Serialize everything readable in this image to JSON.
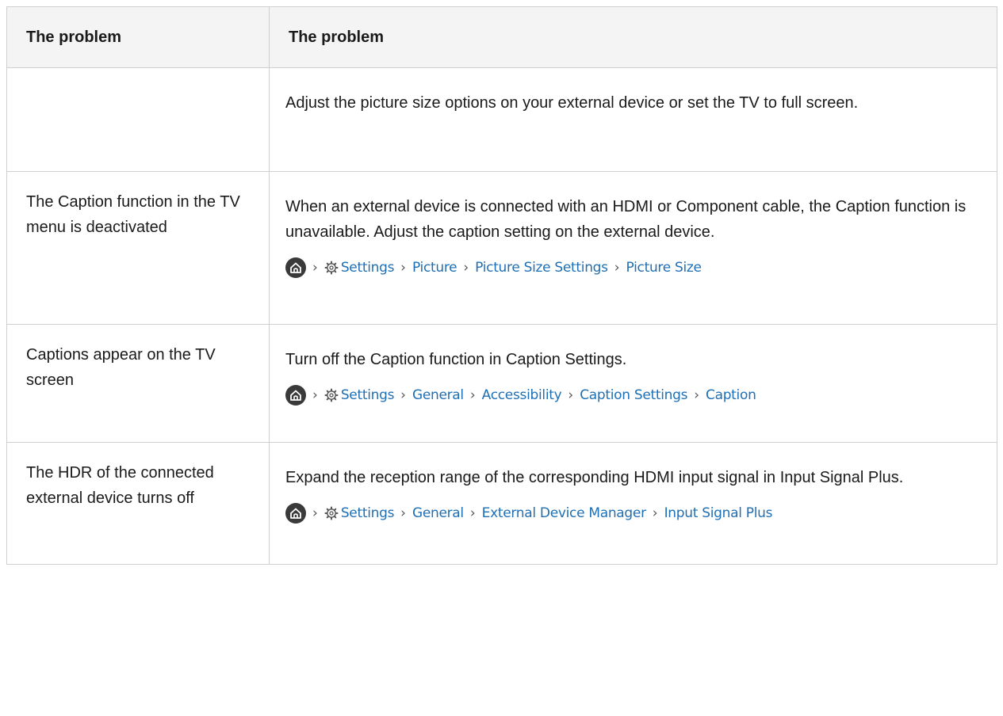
{
  "header": {
    "col1": "The problem",
    "col2": "The problem"
  },
  "rows": [
    {
      "problem": "",
      "solution": "Adjust the picture size options on your external device or set the TV to full screen.",
      "path": []
    },
    {
      "problem": "The Caption function in the TV menu is deactivated",
      "solution": "When an external device is connected with an HDMI or Component cable, the Caption function is unavailable. Adjust the caption setting on the external device.",
      "path": [
        "Settings",
        "Picture",
        "Picture Size Settings",
        "Picture Size"
      ]
    },
    {
      "problem": "Captions appear on the TV screen",
      "solution": "Turn off the Caption function in Caption Settings.",
      "path": [
        "Settings",
        "General",
        "Accessibility",
        "Caption Settings",
        "Caption"
      ]
    },
    {
      "problem": "The HDR of the connected external device turns off",
      "solution": "Expand the reception range of the corresponding HDMI input signal in Input Signal Plus.",
      "path": [
        "Settings",
        "General",
        "External Device Manager",
        "Input Signal Plus"
      ]
    }
  ],
  "icons": {
    "home": "home-icon",
    "settings": "gear-icon",
    "separator": "chevron-right-icon"
  },
  "colors": {
    "link": "#1f6fb5",
    "header_bg": "#f4f4f4",
    "border": "#cfcfcf",
    "home_icon_bg": "#3a3a3a"
  }
}
